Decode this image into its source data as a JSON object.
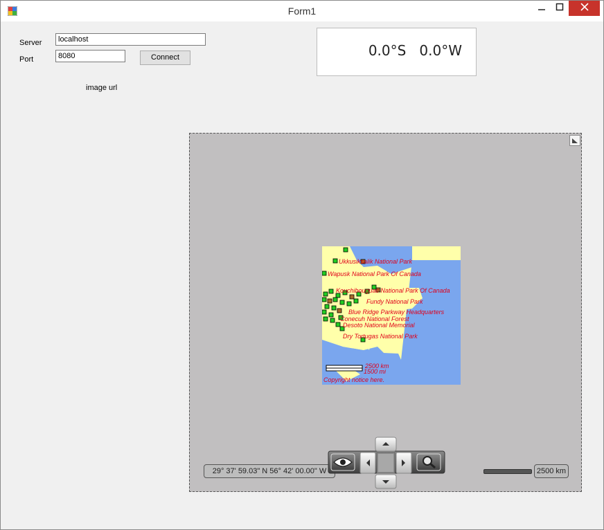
{
  "window": {
    "title": "Form1"
  },
  "form": {
    "server_label": "Server",
    "server_value": "localhost",
    "port_label": "Port",
    "port_value": "8080",
    "connect_label": "Connect",
    "image_url_label": "image url"
  },
  "coords": {
    "lat": "0.0°S",
    "lon": "0.0°W"
  },
  "map": {
    "labels": [
      "Ukkusiksalik National Park",
      "Wapusk National Park Of Canada",
      "Kouchibouguac National Park Of Canada",
      "Fundy National Park",
      "Blue Ridge Parkway Headquarters",
      "Conecuh National Forest",
      "Desoto National Memorial",
      "Dry Tortugas National Park"
    ],
    "scale_km": "2500 km",
    "scale_mi": "1500 mi",
    "copyright": "Copyright notice here.",
    "coordinate_readout": "29° 37' 59.03\" N 56° 42' 00.00\" W",
    "scale_readout": "2500 km",
    "colors": {
      "land": "#ffffaa",
      "water": "#7aa6ee",
      "label": "#e0001a",
      "marker": "#22cc22"
    }
  }
}
